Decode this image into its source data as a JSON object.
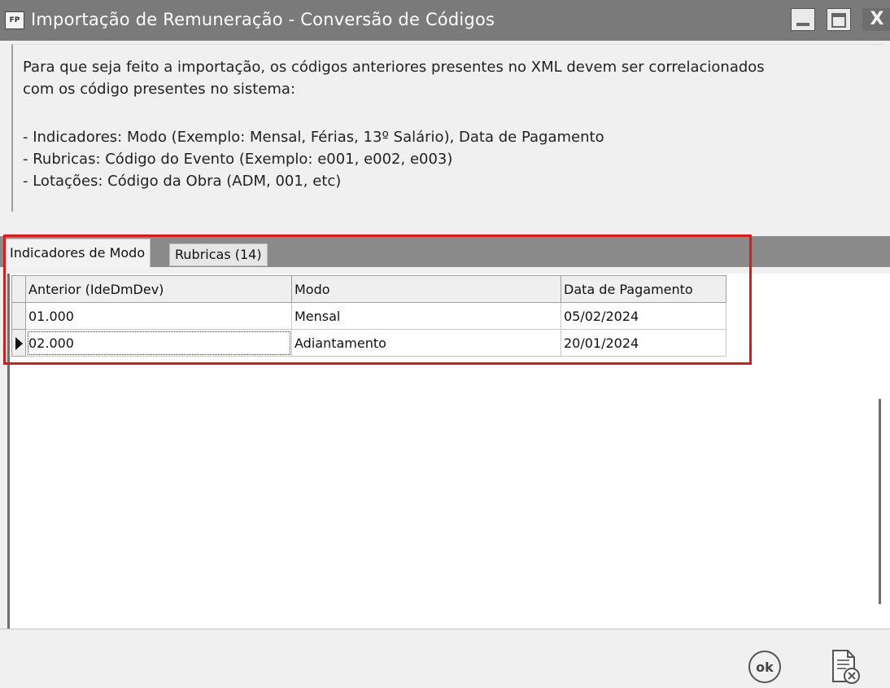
{
  "window": {
    "icon_text": "FP",
    "title": "Importação de Remuneração - Conversão de Códigos",
    "close_glyph": "X"
  },
  "info": {
    "intro_line1": "Para que seja feito a importação, os códigos anteriores presentes no XML devem ser correlacionados",
    "intro_line2": "com os código presentes no sistema:",
    "bullets": [
      "- Indicadores: Modo (Exemplo: Mensal, Férias, 13º Salário), Data de Pagamento",
      "- Rubricas: Código do Evento (Exemplo: e001, e002, e003)",
      "- Lotações: Código da Obra (ADM, 001, etc)"
    ]
  },
  "tabs": [
    {
      "label": "Indicadores de Modo",
      "active": true
    },
    {
      "label": "Rubricas (14)",
      "active": false
    }
  ],
  "grid": {
    "columns": [
      "Anterior (IdeDmDev)",
      "Modo",
      "Data de Pagamento"
    ],
    "rows": [
      {
        "anterior": "01.000",
        "modo": "Mensal",
        "data": "05/02/2024",
        "current": false
      },
      {
        "anterior": "02.000",
        "modo": "Adiantamento",
        "data": "20/01/2024",
        "current": true
      }
    ]
  },
  "footer": {
    "ok_label": "ok",
    "ok_icon": "ok-circle-icon",
    "cancel_icon": "document-cancel-icon"
  },
  "colors": {
    "highlight": "#e01818",
    "titlebar": "#7a7a7a"
  }
}
